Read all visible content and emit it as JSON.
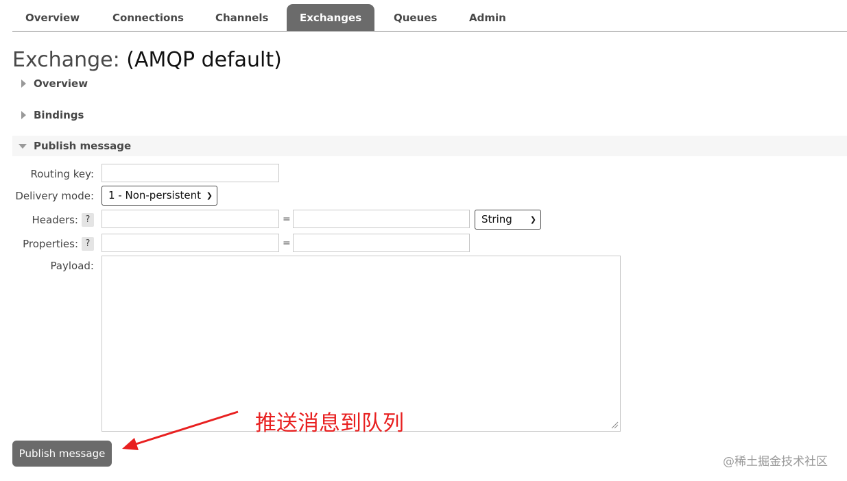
{
  "nav": {
    "tabs": [
      {
        "label": "Overview"
      },
      {
        "label": "Connections"
      },
      {
        "label": "Channels"
      },
      {
        "label": "Exchanges",
        "active": true
      },
      {
        "label": "Queues"
      },
      {
        "label": "Admin"
      }
    ]
  },
  "page": {
    "title_prefix": "Exchange:",
    "title_name": "(AMQP default)"
  },
  "sections": {
    "overview": "Overview",
    "bindings": "Bindings",
    "publish": "Publish message"
  },
  "form": {
    "routing_key_label": "Routing key:",
    "routing_key_value": "",
    "delivery_mode_label": "Delivery mode:",
    "delivery_mode_value": "1 - Non-persistent",
    "headers_label": "Headers:",
    "headers_help": "?",
    "headers_key": "",
    "headers_value": "",
    "equals": "=",
    "headers_type": "String",
    "properties_label": "Properties:",
    "properties_help": "?",
    "properties_key": "",
    "properties_value": "",
    "payload_label": "Payload:",
    "payload_value": ""
  },
  "actions": {
    "publish_button": "Publish message"
  },
  "annotation": {
    "text": "推送消息到队列",
    "color": "#e82020"
  },
  "watermark": "@稀土掘金技术社区",
  "colors": {
    "tab_active_bg": "#6b6b6b",
    "button_bg": "#6b6b6b"
  }
}
